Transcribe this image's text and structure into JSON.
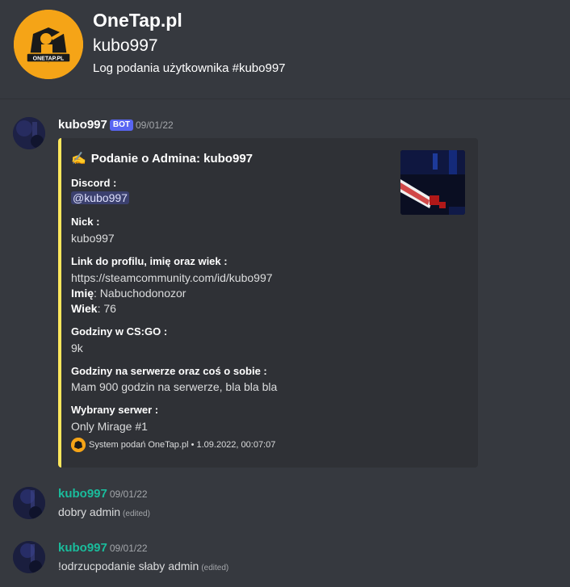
{
  "header": {
    "title": "OneTap.pl",
    "subtitle": "kubo997",
    "description": "Log podania użytkownika #kubo997",
    "logo_text": "ONETAP.PL",
    "logo_color": "#f5a417"
  },
  "messages": [
    {
      "author": "kubo997",
      "bot_tag": "BOT",
      "timestamp": "09/01/22",
      "embed": {
        "accent_color": "#fee75c",
        "title_icon": "✍",
        "title": "Podanie o Admina: kubo997",
        "fields": [
          {
            "name": "Discord :",
            "value": "@kubo997"
          },
          {
            "name": "Nick :",
            "value": "kubo997"
          },
          {
            "name": "Link do profilu, imię oraz wiek :",
            "value_line1": "https://steamcommunity.com/id/kubo997",
            "label_imie": "Imię",
            "value_imie": ": Nabuchodonozor",
            "label_wiek": "Wiek",
            "value_wiek": ": 76"
          },
          {
            "name": "Godziny w CS:GO :",
            "value": "9k"
          },
          {
            "name": "Godziny na serwerze oraz coś o sobie :",
            "value": "Mam 900 godzin na serwerze, bla bla bla"
          },
          {
            "name": "Wybrany serwer :",
            "value": "Only Mirage #1"
          }
        ],
        "footer": "System podań OneTap.pl • 1.09.2022, 00:07:07"
      }
    },
    {
      "author": "kubo997",
      "author_color": "#1abc9c",
      "timestamp": "09/01/22",
      "text": "dobry admin",
      "edited": "(edited)"
    },
    {
      "author": "kubo997",
      "author_color": "#1abc9c",
      "timestamp": "09/01/22",
      "text": "!odrzucpodanie słaby admin",
      "edited": "(edited)"
    }
  ]
}
